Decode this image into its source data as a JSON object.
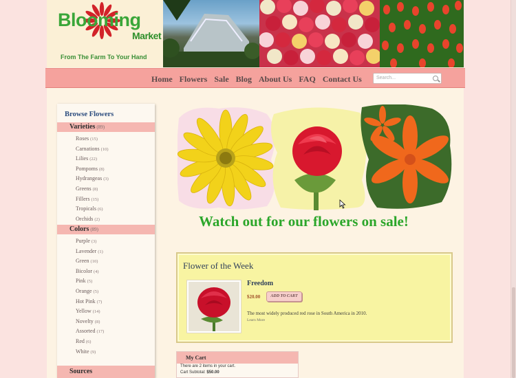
{
  "logo": {
    "title": "Blooming",
    "subtitle": "Market",
    "tagline": "From The Farm To Your Hand"
  },
  "nav": [
    "Home",
    "Flowers",
    "Sale",
    "Blog",
    "About Us",
    "FAQ",
    "Contact Us"
  ],
  "search": {
    "placeholder": "Search..."
  },
  "sidebar": {
    "title": "Browse Flowers",
    "varieties": {
      "label": "Varieties",
      "count": "(89)",
      "items": [
        {
          "name": "Roses",
          "count": "(15)"
        },
        {
          "name": "Carnations",
          "count": "(10)"
        },
        {
          "name": "Lilies",
          "count": "(22)"
        },
        {
          "name": "Pompoms",
          "count": "(8)"
        },
        {
          "name": "Hydrangeas",
          "count": "(3)"
        },
        {
          "name": "Greens",
          "count": "(8)"
        },
        {
          "name": "Fillers",
          "count": "(15)"
        },
        {
          "name": "Tropicals",
          "count": "(6)"
        },
        {
          "name": "Orchids",
          "count": "(2)"
        }
      ]
    },
    "colors": {
      "label": "Colors",
      "count": "(89)",
      "items": [
        {
          "name": "Purple",
          "count": "(3)"
        },
        {
          "name": "Lavender",
          "count": "(1)"
        },
        {
          "name": "Green",
          "count": "(10)"
        },
        {
          "name": "Bicolor",
          "count": "(4)"
        },
        {
          "name": "Pink",
          "count": "(5)"
        },
        {
          "name": "Orange",
          "count": "(5)"
        },
        {
          "name": "Hot Pink",
          "count": "(7)"
        },
        {
          "name": "Yellow",
          "count": "(14)"
        },
        {
          "name": "Novelty",
          "count": "(8)"
        },
        {
          "name": "Assorted",
          "count": "(17)"
        },
        {
          "name": "Red",
          "count": "(6)"
        },
        {
          "name": "White",
          "count": "(9)"
        }
      ]
    },
    "sources": {
      "label": "Sources"
    }
  },
  "banner": {
    "text": "Watch out for our flowers on sale!"
  },
  "flower_of_week": {
    "title": "Flower of the Week",
    "name": "Freedom",
    "price": "$20.00",
    "add_to_cart": "ADD TO CART",
    "description": "The most widely produced red rose in South America in 2010.",
    "learn_more": "Learn More"
  },
  "cart": {
    "title": "My Cart",
    "line1": "There are 2 items in your cart.",
    "subtotal_label": "Cart Subtotal:",
    "subtotal": "$50.00"
  },
  "colors": {
    "accent": "#f5a29d",
    "green": "#2ba62a",
    "page": "#fdf3e3"
  }
}
